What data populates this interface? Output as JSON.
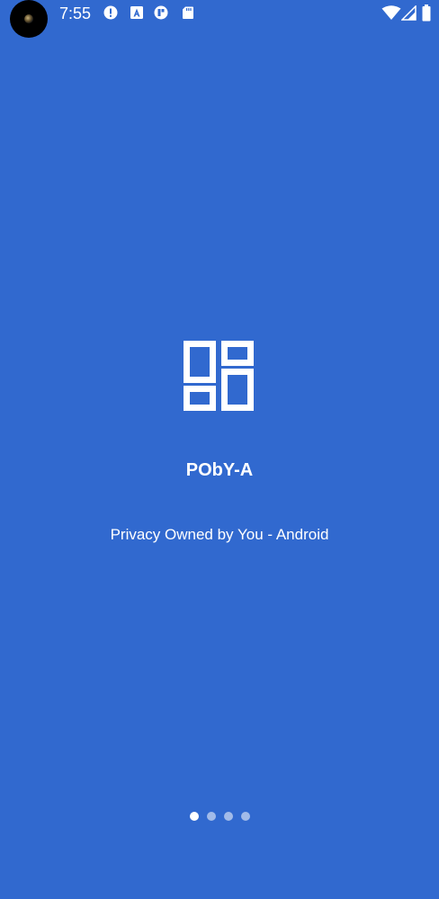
{
  "status_bar": {
    "time": "7:55",
    "notification_icons": [
      "alert-circle-icon",
      "a-box-icon",
      "app-badge-icon",
      "sd-card-icon"
    ],
    "system_icons": [
      "wifi-icon",
      "cell-signal-icon",
      "battery-icon"
    ]
  },
  "app": {
    "title": "PObY-A",
    "subtitle": "Privacy Owned by You - Android",
    "logo_icon": "layout-grid-icon"
  },
  "pager": {
    "page_count": 4,
    "current_page": 1
  },
  "colors": {
    "background": "#3169cf",
    "foreground": "#ffffff"
  }
}
